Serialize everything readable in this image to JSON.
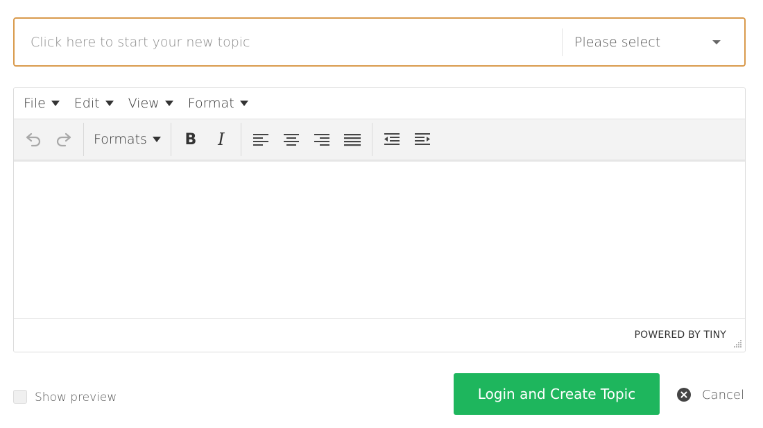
{
  "topic": {
    "title_placeholder": "Click here to start your new topic",
    "category_value": "Please select",
    "accent_color": "#d99a4c"
  },
  "editor": {
    "menu": [
      {
        "label": "File"
      },
      {
        "label": "Edit"
      },
      {
        "label": "View"
      },
      {
        "label": "Format"
      }
    ],
    "toolbar": {
      "formats_label": "Formats",
      "bold_glyph": "B",
      "italic_glyph": "I",
      "icons": [
        "undo-icon",
        "redo-icon",
        "align-left-icon",
        "align-center-icon",
        "align-right-icon",
        "align-justify-icon",
        "outdent-icon",
        "indent-icon"
      ]
    },
    "content": "",
    "powered_by": "POWERED BY TINY"
  },
  "footer": {
    "show_preview_label": "Show preview",
    "show_preview_checked": false,
    "submit_label": "Login and Create Topic",
    "submit_color": "#1eb65d",
    "cancel_label": "Cancel"
  }
}
